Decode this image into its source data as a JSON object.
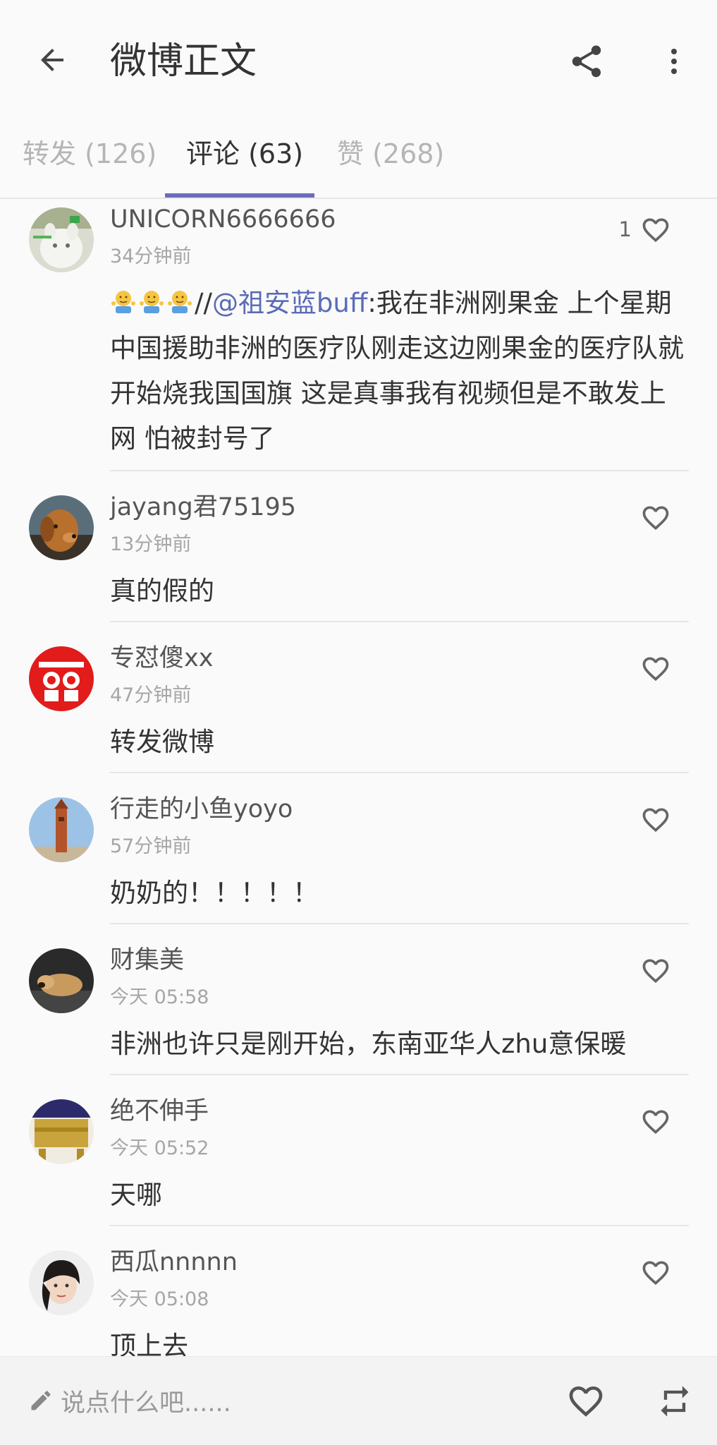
{
  "toolbar": {
    "title": "微博正文",
    "back_icon": "arrow-back-icon",
    "share_icon": "share-icon",
    "more_icon": "more-vertical-icon"
  },
  "tabs": [
    {
      "label": "转发 (126)",
      "active": false
    },
    {
      "label": "评论 (63)",
      "active": true
    },
    {
      "label": "赞 (268)",
      "active": false
    }
  ],
  "accent_color": "#6b6cba",
  "mention_color": "#5b6bb8",
  "comments": [
    {
      "name": "UNICORN6666666",
      "time": "34分钟前",
      "like_count": "1",
      "text_prefix": "//",
      "mention": "@祖安蓝buff",
      "text": ":我在非洲刚果金 上个星期中国援助非洲的医疗队刚走这边刚果金的医疗队就开始烧我国国旗 这是真事我有视频但是不敢发上网 怕被封号了",
      "emojis": [
        "shrug-emoji",
        "shrug-emoji",
        "shrug-emoji"
      ]
    },
    {
      "name": "jayang君75195",
      "time": "13分钟前",
      "text": "真的假的"
    },
    {
      "name": "专怼傻xx",
      "time": "47分钟前",
      "text": "转发微博"
    },
    {
      "name": "行走的小鱼yoyo",
      "time": "57分钟前",
      "text": "奶奶的！！！！！"
    },
    {
      "name": "财集美",
      "time": "今天 05:58",
      "text": "非洲也许只是刚开始，东南亚华人zhu意保暖"
    },
    {
      "name": "绝不伸手",
      "time": "今天 05:52",
      "text": "天哪"
    },
    {
      "name": "西瓜nnnnn",
      "time": "今天 05:08",
      "text": "顶上去"
    }
  ],
  "bottom_bar": {
    "placeholder": "说点什么吧......",
    "pencil_icon": "pencil-icon",
    "like_icon": "heart-icon",
    "repost_icon": "repost-icon"
  }
}
